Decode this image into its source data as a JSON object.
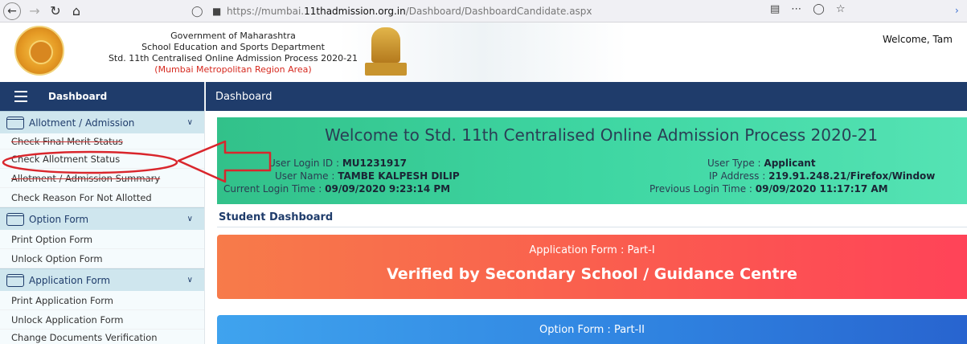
{
  "browser": {
    "url_prefix": "https://mumbai.",
    "url_domain": "11thadmission.org.in",
    "url_path": "/Dashboard/DashboardCandidate.aspx",
    "icons": [
      "back-icon",
      "forward-icon",
      "reload-icon",
      "home-icon",
      "shield-icon",
      "lock-icon",
      "reader-icon",
      "more-icon",
      "pocket-icon",
      "star-icon"
    ]
  },
  "header": {
    "line1": "Government of Maharashtra",
    "line2": "School Education and Sports Department",
    "line3": "Std. 11th Centralised Online Admission Process 2020-21",
    "region": "(Mumbai Metropolitan Region Area)",
    "welcome": "Welcome, Tam"
  },
  "sidebar": {
    "title": "Dashboard",
    "groups": [
      {
        "label": "Allotment / Admission",
        "items": [
          "Check Final Merit Status",
          "Check Allotment Status",
          "Allotment / Admission Summary",
          "Check Reason For Not Allotted"
        ]
      },
      {
        "label": "Option Form",
        "items": [
          "Print Option Form",
          "Unlock Option Form"
        ]
      },
      {
        "label": "Application Form",
        "items": [
          "Print Application Form",
          "Unlock Application Form",
          "Change Documents Verification"
        ]
      }
    ]
  },
  "main": {
    "title": "Dashboard",
    "welcome_title": "Welcome to Std. 11th Centralised Online Admission Process 2020-21",
    "login_id_label": "User Login ID : ",
    "login_id": "MU1231917",
    "user_type_label": "User Type : ",
    "user_type": "Applicant",
    "user_name_label": "User Name : ",
    "user_name": "TAMBE KALPESH DILIP",
    "ip_label": "IP Address : ",
    "ip": "219.91.248.21/Firefox/Window",
    "current_login_label": "Current Login Time : ",
    "current_login": "09/09/2020 9:23:14 PM",
    "previous_login_label": "Previous Login Time : ",
    "previous_login": "09/09/2020 11:17:17 AM",
    "student_dashboard": "Student Dashboard",
    "card1_sub": "Application Form : Part-I",
    "card1_headline": "Verified by Secondary School / Guidance Centre",
    "card2_sub": "Option Form : Part-II"
  },
  "colors": {
    "navy": "#1f3c6b",
    "annotation_red": "#d9262c"
  }
}
